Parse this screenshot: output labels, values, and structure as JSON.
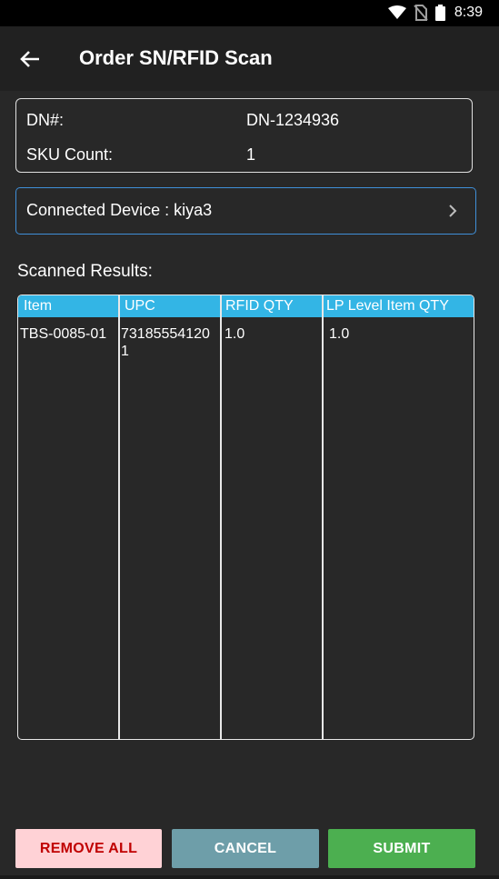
{
  "status_bar": {
    "time": "8:39",
    "icons": [
      "wifi-icon",
      "no-sim-icon",
      "battery-icon"
    ]
  },
  "app_bar": {
    "title": "Order SN/RFID Scan",
    "back_icon": "arrow-left-icon"
  },
  "info": {
    "dn_label": "DN#:",
    "dn_value": "DN-1234936",
    "sku_label": "SKU Count:",
    "sku_value": "1"
  },
  "device": {
    "label": "Connected Device : kiya3",
    "icon": "chevron-right-icon"
  },
  "results": {
    "heading": "Scanned Results:",
    "columns": [
      "Item",
      "UPC",
      "RFID QTY",
      "LP Level Item QTY"
    ],
    "rows": [
      {
        "item": "TBS-0085-01",
        "upc_line1": "73185554120",
        "upc_line2": "1",
        "rfid_qty": "1.0",
        "lp_qty": "1.0"
      }
    ]
  },
  "actions": {
    "remove_all": "REMOVE ALL",
    "cancel": "CANCEL",
    "submit": "SUBMIT"
  },
  "colors": {
    "accent_blue": "#33b5e5",
    "device_border": "#3f8fd8",
    "remove_bg": "#ffd2d6",
    "remove_text": "#c00000",
    "cancel_bg": "#6e9ea9",
    "submit_bg": "#4caf50"
  }
}
